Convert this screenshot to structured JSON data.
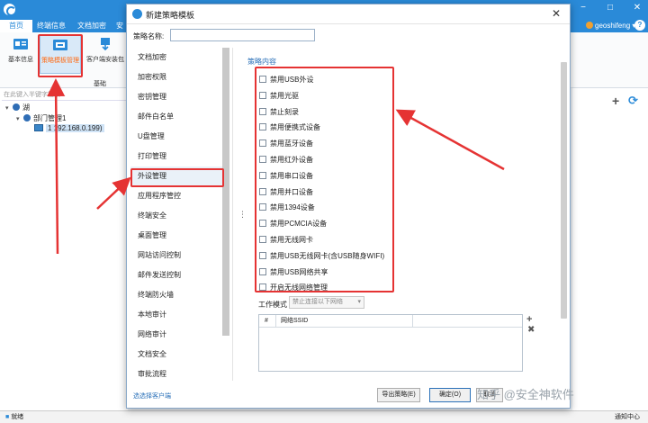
{
  "app": {
    "tabs": [
      "首页",
      "终端信息",
      "文档加密",
      "安"
    ],
    "user": "geoshifeng",
    "toolbar": {
      "items": [
        "基本信息",
        "策略模板管理",
        "客户端安装包"
      ],
      "group_label": "基础"
    },
    "search_placeholder": "在此键入半键字搜索...",
    "tree": {
      "root": "湖",
      "group": "部门管理1",
      "client": "1 192.168.0.199)"
    },
    "status": {
      "ready": "就绪",
      "notice": "通知中心"
    }
  },
  "dialog": {
    "title": "新建策略模板",
    "name_label": "策略名称:",
    "name_value": "",
    "categories": [
      "文档加密",
      "加密权限",
      "密钥管理",
      "邮件白名单",
      "U盘管理",
      "打印管理",
      "外设管理",
      "应用程序管控",
      "终端安全",
      "桌面管理",
      "网站访问控制",
      "邮件发送控制",
      "终端防火墙",
      "本地审计",
      "网络审计",
      "文档安全",
      "审批流程"
    ],
    "active_category": "外设管理",
    "content_title": "策略内容",
    "options": [
      "禁用USB外设",
      "禁用光驱",
      "禁止刻录",
      "禁用便携式设备",
      "禁用蓝牙设备",
      "禁用红外设备",
      "禁用串口设备",
      "禁用并口设备",
      "禁用1394设备",
      "禁用PCMCIA设备",
      "禁用无线网卡",
      "禁用USB无线网卡(含USB随身WIFI)",
      "禁用USB网络共享",
      "开启无线网络管理"
    ],
    "work_mode_label": "工作模式",
    "work_mode_value": "禁止连接以下网络",
    "ssid_table": {
      "col_index": "#",
      "col_ssid": "网络SSID"
    },
    "footer_link": "选选择客户端",
    "buttons": {
      "export": "导出策略(E)",
      "ok": "确定(O)",
      "cancel": "取消"
    },
    "watermark": "知乎 @安全神软件"
  }
}
